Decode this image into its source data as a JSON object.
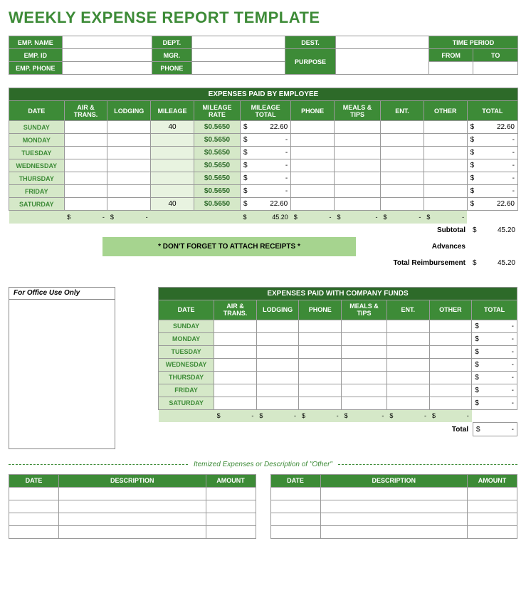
{
  "title": "WEEKLY EXPENSE REPORT TEMPLATE",
  "info": {
    "emp_name": "EMP. NAME",
    "emp_id": "EMP. ID",
    "emp_phone": "EMP. PHONE",
    "dept": "DEPT.",
    "mgr": "MGR.",
    "phone": "PHONE",
    "dest": "DEST.",
    "purpose": "PURPOSE",
    "time_period": "TIME PERIOD",
    "from": "FROM",
    "to": "TO"
  },
  "emp_table": {
    "title": "EXPENSES PAID BY EMPLOYEE",
    "cols": [
      "DATE",
      "AIR & TRANS.",
      "LODGING",
      "MILEAGE",
      "MILEAGE RATE",
      "MILEAGE TOTAL",
      "PHONE",
      "MEALS & TIPS",
      "ENT.",
      "OTHER",
      "TOTAL"
    ],
    "days": [
      "SUNDAY",
      "MONDAY",
      "TUESDAY",
      "WEDNESDAY",
      "THURSDAY",
      "FRIDAY",
      "SATURDAY"
    ],
    "mileage": [
      "40",
      "",
      "",
      "",
      "",
      "",
      "40"
    ],
    "rate": [
      "$0.5650",
      "$0.5650",
      "$0.5650",
      "$0.5650",
      "$0.5650",
      "$0.5650",
      "$0.5650"
    ],
    "mtotal_sym": [
      "$",
      "$",
      "$",
      "$",
      "$",
      "$",
      "$"
    ],
    "mtotal_val": [
      "22.60",
      "-",
      "-",
      "-",
      "-",
      "-",
      "22.60"
    ],
    "total_sym": [
      "$",
      "$",
      "$",
      "$",
      "$",
      "$",
      "$"
    ],
    "total_val": [
      "22.60",
      "-",
      "-",
      "-",
      "-",
      "-",
      "22.60"
    ],
    "sums": {
      "air_s": "$",
      "air_v": "-",
      "lodg_s": "$",
      "lodg_v": "-",
      "mt_s": "$",
      "mt_v": "45.20",
      "ph_s": "$",
      "ph_v": "-",
      "meal_s": "$",
      "meal_v": "-",
      "ent_s": "$",
      "ent_v": "-",
      "oth_s": "$",
      "oth_v": "-"
    },
    "banner": "* DON'T FORGET TO ATTACH RECEIPTS *",
    "subtotal_lbl": "Subtotal",
    "subtotal_s": "$",
    "subtotal_v": "45.20",
    "advances_lbl": "Advances",
    "reimb_lbl": "Total Reimbursement",
    "reimb_s": "$",
    "reimb_v": "45.20"
  },
  "office_lbl": "For Office Use Only",
  "co_table": {
    "title": "EXPENSES PAID WITH COMPANY FUNDS",
    "cols": [
      "DATE",
      "AIR & TRANS.",
      "LODGING",
      "PHONE",
      "MEALS & TIPS",
      "ENT.",
      "OTHER",
      "TOTAL"
    ],
    "days": [
      "SUNDAY",
      "MONDAY",
      "TUESDAY",
      "WEDNESDAY",
      "THURSDAY",
      "FRIDAY",
      "SATURDAY"
    ],
    "tot_s": [
      "$",
      "$",
      "$",
      "$",
      "$",
      "$",
      "$"
    ],
    "tot_v": [
      "-",
      "-",
      "-",
      "-",
      "-",
      "-",
      "-"
    ],
    "sums": {
      "air_s": "$",
      "air_v": "-",
      "lodg_s": "$",
      "lodg_v": "-",
      "ph_s": "$",
      "ph_v": "-",
      "meal_s": "$",
      "meal_v": "-",
      "ent_s": "$",
      "ent_v": "-",
      "oth_s": "$",
      "oth_v": "-"
    },
    "total_lbl": "Total",
    "total_s": "$",
    "total_v": "-"
  },
  "divider": "Itemized Expenses or Description of \"Other\"",
  "itemized_cols": [
    "DATE",
    "DESCRIPTION",
    "AMOUNT"
  ]
}
